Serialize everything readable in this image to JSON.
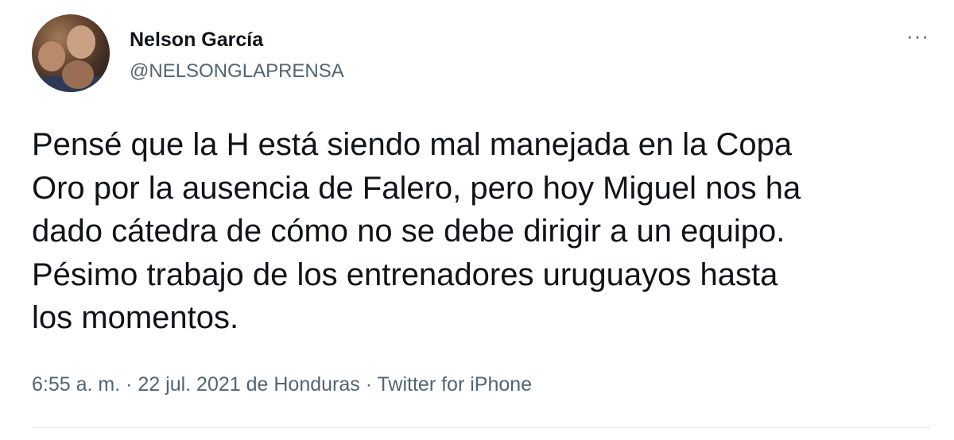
{
  "author": {
    "name": "Nelson García",
    "handle": "@NELSONGLAPRENSA"
  },
  "menu": {
    "more_label": "···"
  },
  "tweet": {
    "lines": [
      "Pensé que la H está siendo mal manejada en la Copa",
      "Oro por la ausencia de Falero, pero hoy Miguel nos ha",
      "dado cátedra de cómo no se debe dirigir a un equipo.",
      "Pésimo trabajo de los entrenadores uruguayos hasta",
      "los momentos."
    ]
  },
  "meta": {
    "text": "6:55 a. m. · 22 jul. 2021 de Honduras · Twitter for iPhone"
  },
  "colors": {
    "primary_text": "#0f1419",
    "secondary_text": "#536471",
    "background": "#ffffff"
  }
}
